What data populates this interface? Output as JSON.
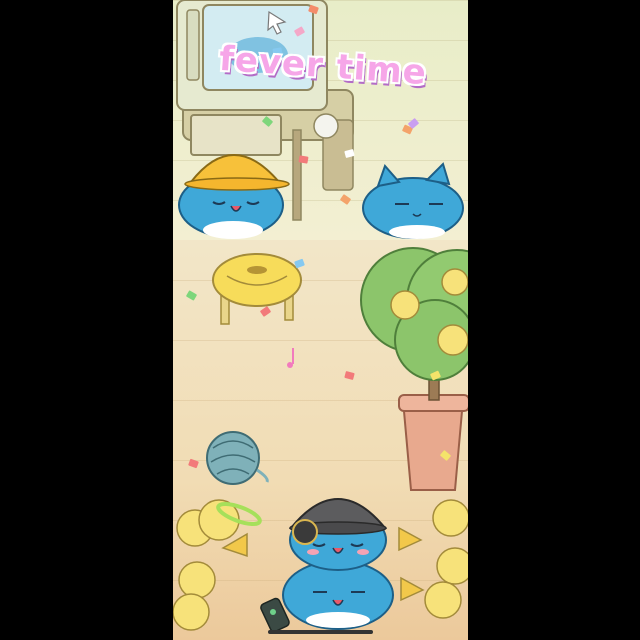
{
  "screen": {
    "banner_text": "fever time"
  },
  "scene": {
    "characters": [
      "cat-hardhat",
      "cat-sleeping",
      "cat-stack-bottom",
      "cat-beanie"
    ],
    "objects": [
      "computer-desk",
      "yellow-stool",
      "yarn-ball",
      "potted-tree",
      "chick-band"
    ],
    "icons": [
      "cursor-icon",
      "game-controller-icon",
      "green-halo-icon",
      "music-note-icon"
    ]
  },
  "colors": {
    "cat_blue": "#3fa8d8",
    "banner_pink": "#f6a6e8",
    "banner_outline": "#b36cc7",
    "hardhat_yellow": "#f7c13a",
    "chick_yellow": "#f7e27a",
    "tree_green": "#8cc56b",
    "pot": "#e8a98e"
  }
}
